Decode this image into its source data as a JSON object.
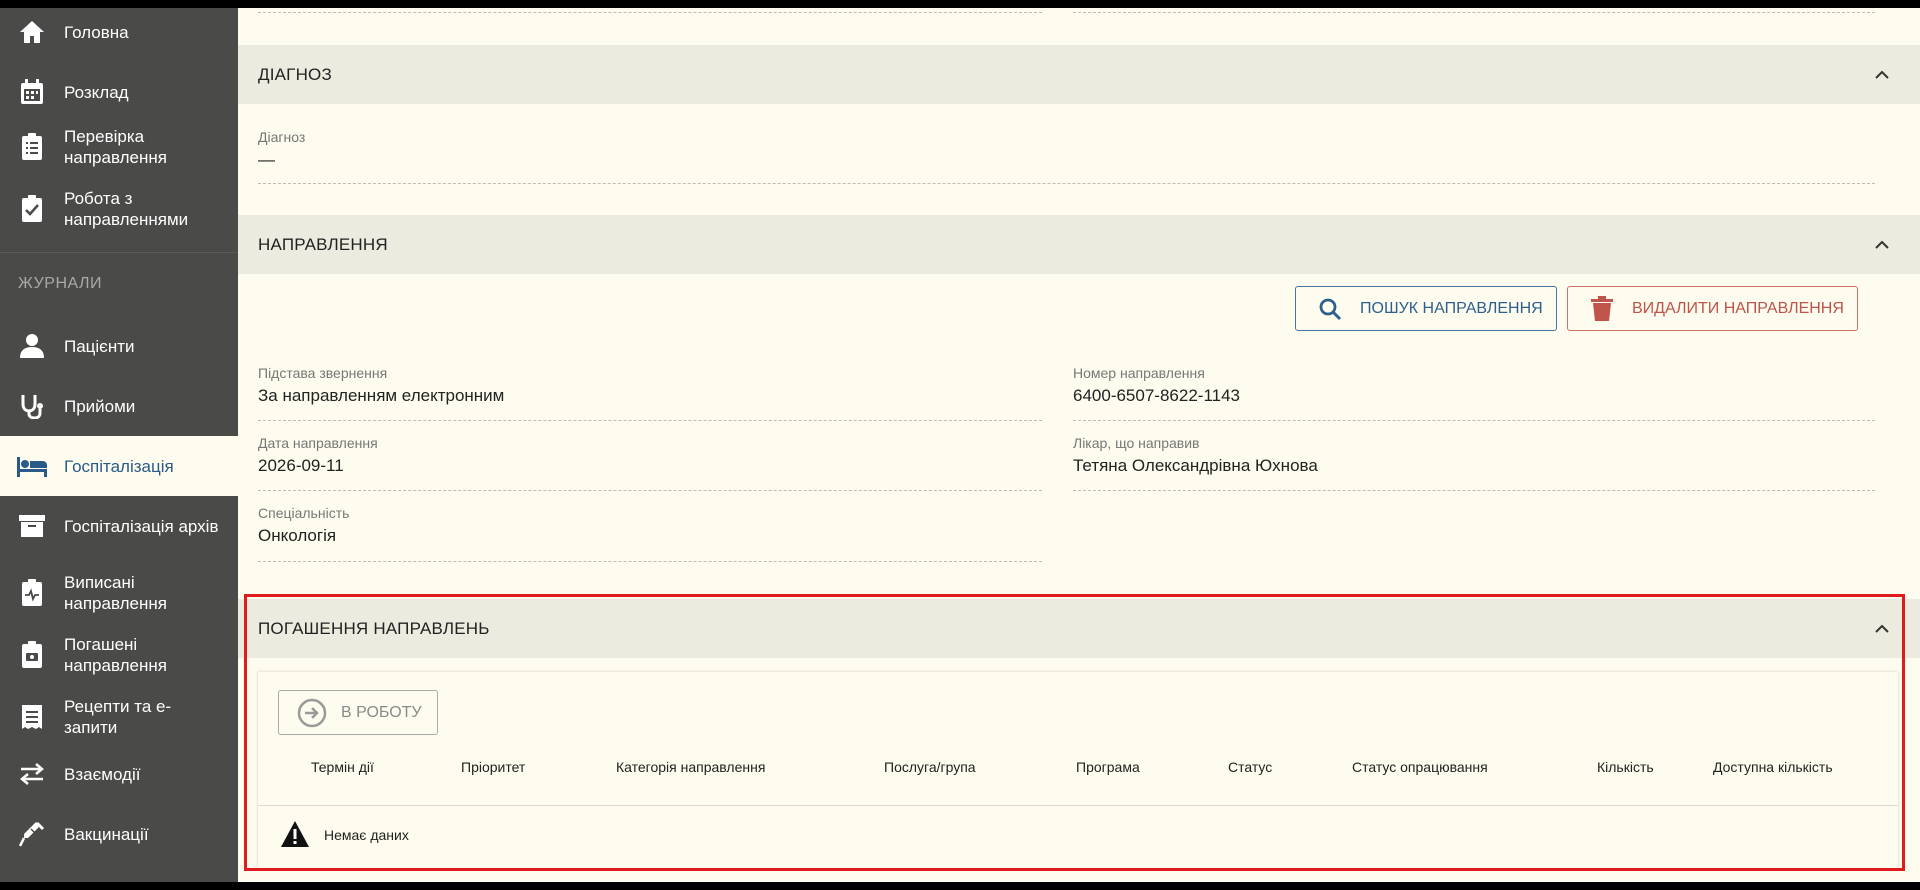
{
  "sidebar": {
    "items": [
      {
        "label": "Головна"
      },
      {
        "label": "Розклад"
      },
      {
        "label": "Перевірка направлення"
      },
      {
        "label": "Робота з направленнями"
      },
      {
        "label": "Пацієнти"
      },
      {
        "label": "Прийоми"
      },
      {
        "label": "Госпіталізація"
      },
      {
        "label": "Госпіталізація архів"
      },
      {
        "label": "Виписані направлення"
      },
      {
        "label": "Погашені направлення"
      },
      {
        "label": "Рецепти та е-запити"
      },
      {
        "label": "Взаємодії"
      },
      {
        "label": "Вакцинації"
      }
    ],
    "group_label": "ЖУРНАЛИ",
    "active_item": "Госпіталізація"
  },
  "diagnosis": {
    "header": "ДІАГНОЗ",
    "label": "Діагноз",
    "value": "—"
  },
  "referral": {
    "header": "НАПРАВЛЕННЯ",
    "search_button": "ПОШУК НАПРАВЛЕННЯ",
    "delete_button": "ВИДАЛИТИ НАПРАВЛЕННЯ",
    "fields": {
      "basis_label": "Підстава звернення",
      "basis_value": "За направленням електронним",
      "number_label": "Номер направлення",
      "number_value": "6400-6507-8622-1143",
      "date_label": "Дата направлення",
      "date_value": "2026-09-11",
      "doctor_label": "Лікар, що направив",
      "doctor_value": "Тетяна Олександрівна Юхнова",
      "specialty_label": "Спеціальність",
      "specialty_value": "Онкологія"
    }
  },
  "repayment": {
    "header": "ПОГАШЕННЯ НАПРАВЛЕНЬ",
    "work_button": "В РОБОТУ",
    "columns": [
      "Термін дії",
      "Пріоритет",
      "Категорія направлення",
      "Послуга/група",
      "Програма",
      "Статус",
      "Статус опрацювання",
      "Кількість",
      "Доступна кількість"
    ],
    "no_data": "Немає даних"
  },
  "colors": {
    "sidebar_bg": "#4a4a48",
    "main_bg": "#fdfcee",
    "section_header_bg": "#ecebdf",
    "accent_blue": "#2f5f8f",
    "danger_red": "#c0534a",
    "highlight": "#e01b1b"
  }
}
